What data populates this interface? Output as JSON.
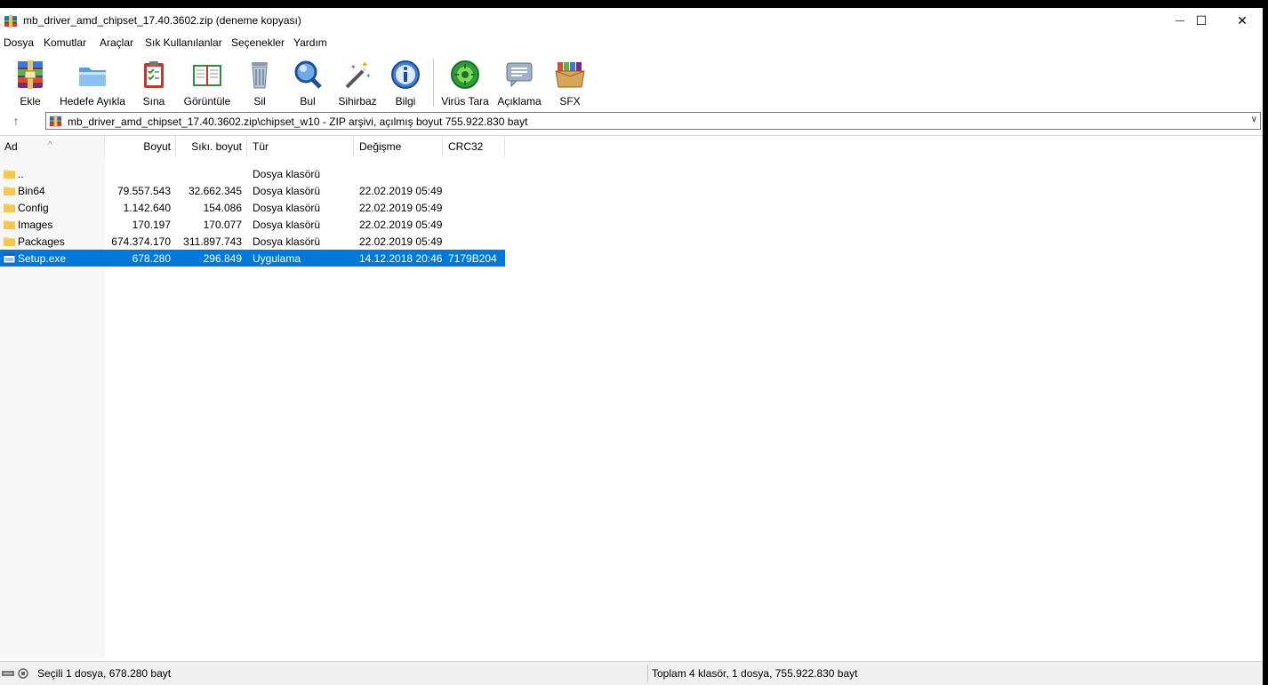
{
  "window": {
    "title": "mb_driver_amd_chipset_17.40.3602.zip (deneme kopyası)",
    "controls": {
      "minimize": "—",
      "maximize": "☐",
      "close": "✕"
    }
  },
  "menu": [
    "Dosya",
    "Komutlar",
    "Araçlar",
    "Sık Kullanılanlar",
    "Seçenekler",
    "Yardım"
  ],
  "toolbar": [
    {
      "label": "Ekle",
      "icon": "add-archive-icon"
    },
    {
      "label": "Hedefe Ayıkla",
      "icon": "extract-folder-icon"
    },
    {
      "label": "Sına",
      "icon": "test-clipboard-icon"
    },
    {
      "label": "Görüntüle",
      "icon": "view-book-icon"
    },
    {
      "label": "Sil",
      "icon": "trash-icon"
    },
    {
      "label": "Bul",
      "icon": "magnifier-icon"
    },
    {
      "label": "Sihirbaz",
      "icon": "wizard-wand-icon"
    },
    {
      "label": "Bilgi",
      "icon": "info-icon"
    },
    {
      "label": "Virüs Tara",
      "icon": "virus-scan-icon"
    },
    {
      "label": "Açıklama",
      "icon": "comment-icon"
    },
    {
      "label": "SFX",
      "icon": "sfx-box-icon"
    }
  ],
  "address": {
    "path": "mb_driver_amd_chipset_17.40.3602.zip\\chipset_w10 - ZIP arşivi, açılmış boyut 755.922.830 bayt"
  },
  "columns": {
    "name": "Ad",
    "size": "Boyut",
    "packed": "Sıkı. boyut",
    "type": "Tür",
    "modified": "Değişme",
    "crc": "CRC32"
  },
  "files": [
    {
      "name": "..",
      "size": "",
      "packed": "",
      "type": "Dosya klasörü",
      "modified": "",
      "crc": "",
      "icon": "folder-icon",
      "selected": false
    },
    {
      "name": "Bin64",
      "size": "79.557.543",
      "packed": "32.662.345",
      "type": "Dosya klasörü",
      "modified": "22.02.2019 05:49",
      "crc": "",
      "icon": "folder-icon",
      "selected": false
    },
    {
      "name": "Config",
      "size": "1.142.640",
      "packed": "154.086",
      "type": "Dosya klasörü",
      "modified": "22.02.2019 05:49",
      "crc": "",
      "icon": "folder-icon",
      "selected": false
    },
    {
      "name": "Images",
      "size": "170.197",
      "packed": "170.077",
      "type": "Dosya klasörü",
      "modified": "22.02.2019 05:49",
      "crc": "",
      "icon": "folder-icon",
      "selected": false
    },
    {
      "name": "Packages",
      "size": "674.374.170",
      "packed": "311.897.743",
      "type": "Dosya klasörü",
      "modified": "22.02.2019 05:49",
      "crc": "",
      "icon": "folder-icon",
      "selected": false
    },
    {
      "name": "Setup.exe",
      "size": "678.280",
      "packed": "296.849",
      "type": "Uygulama",
      "modified": "14.12.2018 20:46",
      "crc": "7179B204",
      "icon": "exe-icon",
      "selected": true
    }
  ],
  "status": {
    "left": "Seçili 1 dosya, 678.280 bayt",
    "right": "Toplam 4 klasör, 1 dosya, 755.922.830 bayt"
  },
  "colors": {
    "selection": "#0078d7",
    "folder": "#f8d775"
  }
}
